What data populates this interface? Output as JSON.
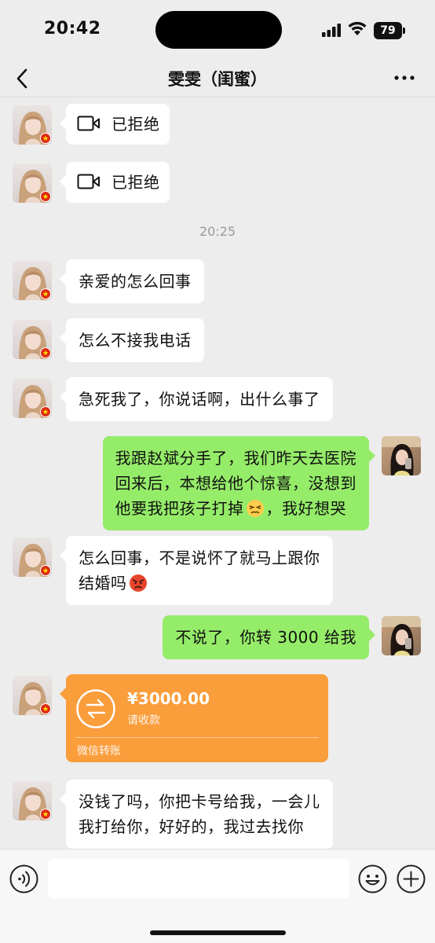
{
  "status_bar": {
    "time": "20:42",
    "battery": "79"
  },
  "nav": {
    "title": "雯雯（闺蜜）"
  },
  "messages": {
    "call1": "已拒绝",
    "call2": "已拒绝",
    "timestamp": "20:25",
    "m1": "亲爱的怎么回事",
    "m2": "怎么不接我电话",
    "m3": "急死我了，你说话啊，出什么事了",
    "m4_part1": "我跟赵斌分手了，我们昨天去医院\n回来后，本想给他个惊喜，没想到\n他要我把孩子打掉",
    "m4_part2": "，我好想哭",
    "m5_part1": "怎么回事，不是说怀了就马上跟你\n结婚吗",
    "m6": "不说了，你转 3000 给我",
    "m8": "没钱了吗，你把卡号给我，一会儿\n我打给你，好好的，我过去找你"
  },
  "transfer": {
    "amount": "¥3000.00",
    "status": "请收款",
    "footer": "微信转账"
  },
  "icons": {
    "emoji_m4": "persevering-face-icon",
    "emoji_m5": "angry-face-icon"
  },
  "colors": {
    "chat_background": "#ededed",
    "sent_bubble": "#95ec69",
    "received_bubble": "#ffffff",
    "transfer_card": "#fa9d3b"
  }
}
